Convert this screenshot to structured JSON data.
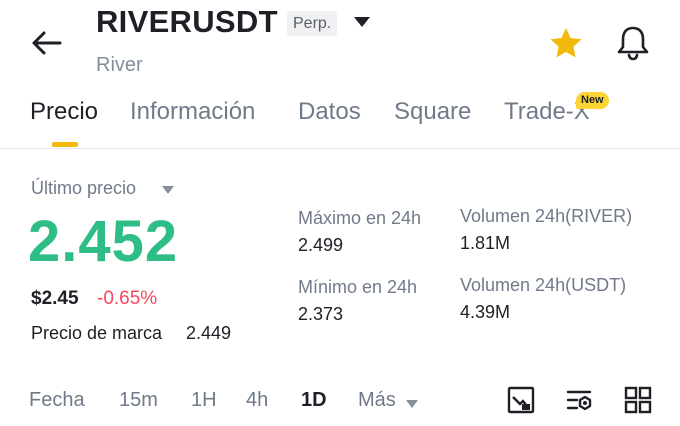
{
  "header": {
    "back_icon": "arrow-left-icon",
    "symbol": "RIVERUSDT",
    "contract_type": "Perp.",
    "subtitle": "River",
    "favorite_icon": "star-icon",
    "favorite_color": "#f0b90b",
    "notification_icon": "bell-icon"
  },
  "tabs": [
    {
      "label": "Precio",
      "active": true
    },
    {
      "label": "Información",
      "active": false
    },
    {
      "label": "Datos",
      "active": false
    },
    {
      "label": "Square",
      "active": false
    },
    {
      "label": "Trade-X",
      "active": false,
      "badge": "New"
    }
  ],
  "price": {
    "last_label": "Último precio",
    "last_price": "2.452",
    "usd_value": "$2.45",
    "change": "-0.65%",
    "mark_label": "Precio de marca",
    "mark_value": "2.449",
    "up_color": "#2ebd85",
    "down_color": "#f6465d"
  },
  "stats": {
    "high_label": "Máximo en 24h",
    "high_value": "2.499",
    "low_label": "Mínimo en 24h",
    "low_value": "2.373",
    "vol_base_label": "Volumen 24h(RIVER)",
    "vol_base_value": "1.81M",
    "vol_quote_label": "Volumen 24h(USDT)",
    "vol_quote_value": "4.39M"
  },
  "timeframes": {
    "items": [
      "Fecha",
      "15m",
      "1H",
      "4h",
      "1D",
      "Más"
    ],
    "active": "1D"
  },
  "tools": [
    "chart-indicator-icon",
    "chart-settings-icon",
    "layout-grid-icon"
  ]
}
